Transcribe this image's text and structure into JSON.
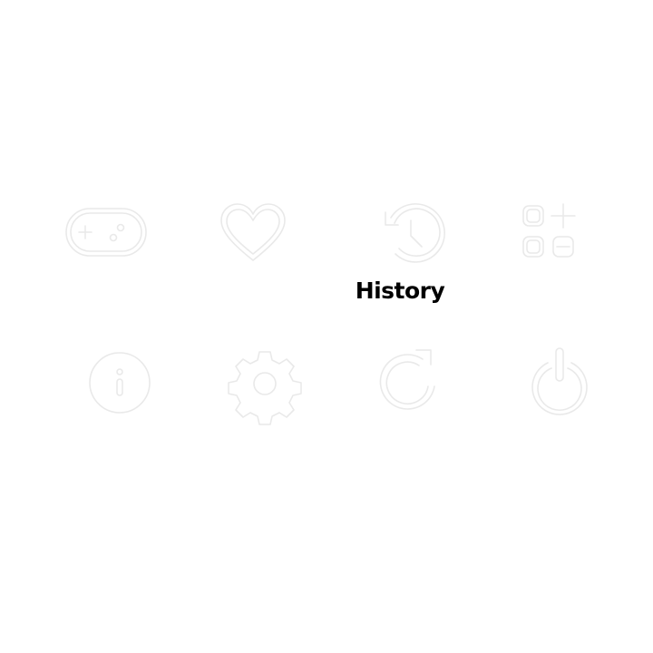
{
  "menu": {
    "items": [
      {
        "id": "games",
        "icon": "gamepad-icon",
        "label": ""
      },
      {
        "id": "favorites",
        "icon": "heart-icon",
        "label": ""
      },
      {
        "id": "history",
        "icon": "history-icon",
        "label": "History"
      },
      {
        "id": "apps",
        "icon": "apps-grid-icon",
        "label": ""
      },
      {
        "id": "info",
        "icon": "info-icon",
        "label": ""
      },
      {
        "id": "settings",
        "icon": "gear-icon",
        "label": ""
      },
      {
        "id": "restart",
        "icon": "restart-icon",
        "label": ""
      },
      {
        "id": "power",
        "icon": "power-icon",
        "label": ""
      }
    ],
    "selected": "history"
  },
  "colors": {
    "icon_idle": "#e9e9e9",
    "label": "#000000",
    "background": "#ffffff"
  }
}
